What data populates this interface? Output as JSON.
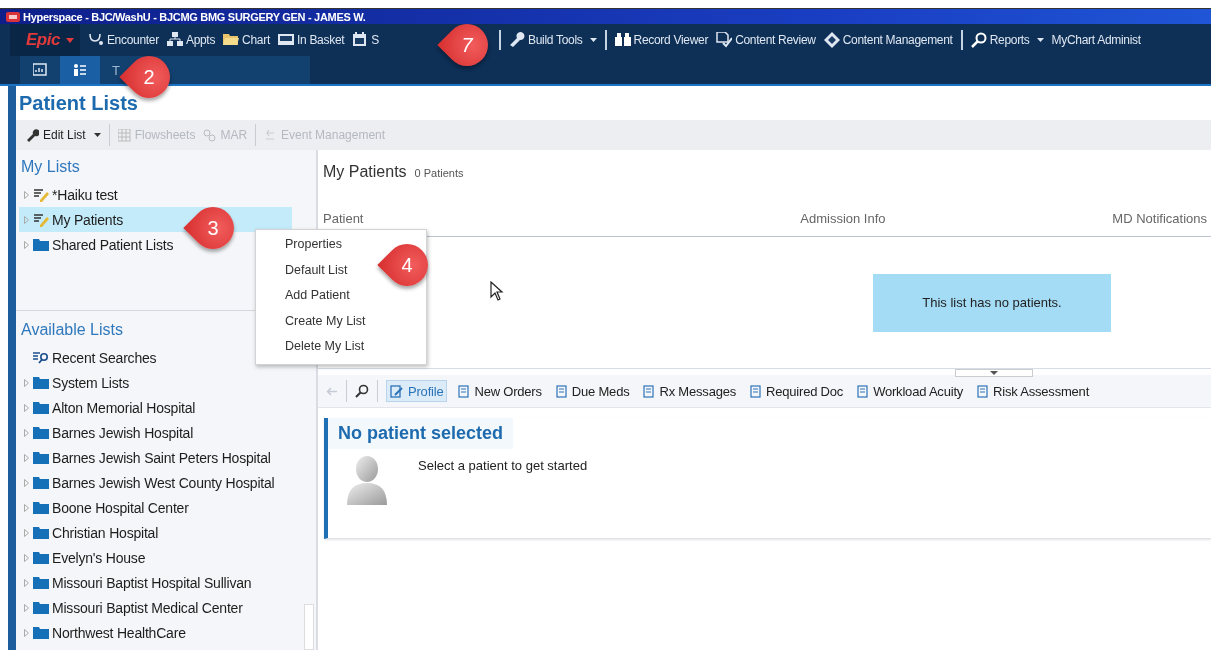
{
  "window": {
    "title": "Hyperspace - BJC/WashU - BJCMG BMG SURGERY GEN - JAMES W."
  },
  "menu_bar": {
    "brand": "Epic",
    "groups": [
      [
        {
          "label": "Encounter",
          "dropdown": false
        },
        {
          "label": "Appts",
          "dropdown": false
        },
        {
          "label": "Chart",
          "dropdown": false
        },
        {
          "label": "In Basket",
          "dropdown": false
        },
        {
          "label": "S",
          "dropdown": false
        }
      ],
      [
        {
          "label": "Build Tools",
          "dropdown": true
        }
      ],
      [
        {
          "label": "Record Viewer",
          "dropdown": false
        },
        {
          "label": "Content Review",
          "dropdown": false
        },
        {
          "label": "Content Management",
          "dropdown": false
        }
      ],
      [
        {
          "label": "Reports",
          "dropdown": true
        },
        {
          "label": "MyChart Administ",
          "dropdown": false
        }
      ]
    ]
  },
  "activity_tabs": [
    {
      "kind": "icon",
      "selected": false
    },
    {
      "kind": "icon",
      "selected": true
    },
    {
      "kind": "text",
      "label": "T",
      "selected": false
    }
  ],
  "page_title": "Patient Lists",
  "toolbar": [
    {
      "label": "Edit List",
      "disabled": false,
      "dropdown": true
    },
    {
      "label": "Flowsheets",
      "disabled": true,
      "dropdown": false
    },
    {
      "label": "MAR",
      "disabled": true,
      "dropdown": false
    },
    {
      "label": "Event Management",
      "disabled": true,
      "dropdown": false
    }
  ],
  "my_lists": {
    "title": "My Lists",
    "items": [
      {
        "label": "*Haiku test",
        "kind": "list",
        "selected": false
      },
      {
        "label": "My Patients",
        "kind": "list",
        "selected": true
      },
      {
        "label": "Shared Patient Lists",
        "kind": "folder",
        "selected": false
      }
    ]
  },
  "available_lists": {
    "title": "Available Lists",
    "items": [
      {
        "label": "Recent Searches",
        "kind": "search",
        "selected": false
      },
      {
        "label": "System Lists",
        "kind": "folder",
        "selected": false
      },
      {
        "label": "Alton Memorial Hospital",
        "kind": "folder",
        "selected": false
      },
      {
        "label": "Barnes Jewish Hospital",
        "kind": "folder",
        "selected": false
      },
      {
        "label": "Barnes Jewish Saint Peters Hospital",
        "kind": "folder",
        "selected": false
      },
      {
        "label": "Barnes Jewish West County Hospital",
        "kind": "folder",
        "selected": false
      },
      {
        "label": "Boone Hospital Center",
        "kind": "folder",
        "selected": false
      },
      {
        "label": "Christian Hospital",
        "kind": "folder",
        "selected": false
      },
      {
        "label": "Evelyn's House",
        "kind": "folder",
        "selected": false
      },
      {
        "label": "Missouri Baptist Hospital Sullivan",
        "kind": "folder",
        "selected": false
      },
      {
        "label": "Missouri Baptist Medical Center",
        "kind": "folder",
        "selected": false
      },
      {
        "label": "Northwest HealthCare",
        "kind": "folder",
        "selected": false
      }
    ]
  },
  "patient_list": {
    "title": "My Patients",
    "count": "0 Patients",
    "columns": [
      "Patient",
      "Admission Info",
      "MD Notifications"
    ],
    "empty_message": "This list has no patients."
  },
  "context_menu": [
    "Properties",
    "Default List",
    "Add Patient",
    "Create My List",
    "Delete My List"
  ],
  "report_tabs": [
    {
      "label": "Profile",
      "selected": true
    },
    {
      "label": "New Orders",
      "selected": false
    },
    {
      "label": "Due Meds",
      "selected": false
    },
    {
      "label": "Rx Messages",
      "selected": false
    },
    {
      "label": "Required Doc",
      "selected": false
    },
    {
      "label": "Workload Acuity",
      "selected": false
    },
    {
      "label": "Risk Assessment",
      "selected": false
    }
  ],
  "patient_card": {
    "title": "No patient selected",
    "message": "Select a patient to get started"
  },
  "callouts": [
    "7",
    "2",
    "3",
    "4"
  ]
}
